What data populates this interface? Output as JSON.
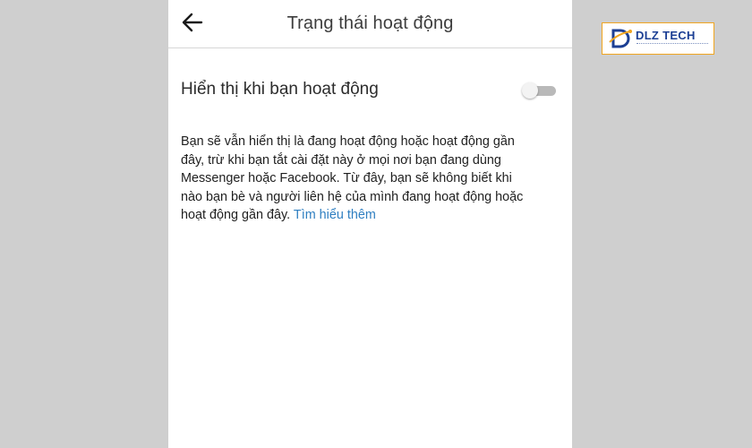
{
  "header": {
    "title": "Trạng thái hoạt động",
    "back_icon": "arrow-left-icon"
  },
  "setting": {
    "label": "Hiển thị khi bạn hoạt động",
    "toggle_on": false
  },
  "description": {
    "lines": [
      "Bạn sẽ vẫn hiển thị là đang hoạt động hoặc hoạt động gần",
      "đây, trừ khi bạn tắt cài đặt này ở mọi nơi bạn đang dùng",
      "Messenger hoặc Facebook. Từ đây, bạn sẽ không biết khi",
      "nào bạn bè và người liên hệ của mình đang hoạt động hoặc",
      "hoạt động gần đây. "
    ],
    "link": "Tìm hiểu thêm"
  },
  "logo": {
    "text": "DLZ TECH"
  },
  "colors": {
    "link": "#2f7fc1",
    "background": "#cfcfcf",
    "logo_border": "#f0a520",
    "logo_text": "#1c3f94"
  }
}
